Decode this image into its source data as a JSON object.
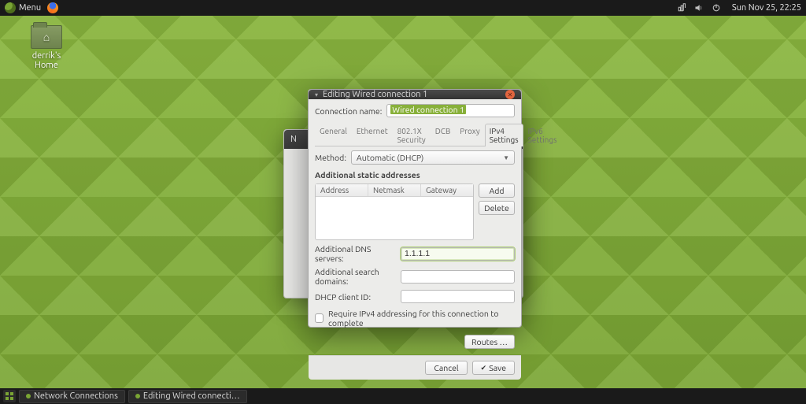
{
  "top_panel": {
    "menu_label": "Menu",
    "clock": "Sun Nov 25, 22:25"
  },
  "desktop": {
    "home_folder_label": "derrik's Home"
  },
  "bottom_panel": {
    "task1": "Network Connections",
    "task2": "Editing Wired connecti…"
  },
  "back_dialog": {
    "title": "N"
  },
  "dialog": {
    "title": "Editing Wired connection 1",
    "conn_name_label": "Connection name:",
    "conn_name_value": "Wired connection 1",
    "tabs": {
      "general": "General",
      "ethernet": "Ethernet",
      "security": "802.1X Security",
      "dcb": "DCB",
      "proxy": "Proxy",
      "ipv4": "IPv4 Settings",
      "ipv6": "IPv6 Settings"
    },
    "method_label": "Method:",
    "method_value": "Automatic (DHCP)",
    "addresses_section": "Additional static addresses",
    "addr_headers": {
      "address": "Address",
      "netmask": "Netmask",
      "gateway": "Gateway"
    },
    "add_btn": "Add",
    "delete_btn": "Delete",
    "dns_label": "Additional DNS servers:",
    "dns_value": "1.1.1.1",
    "search_label": "Additional search domains:",
    "search_value": "",
    "dhcp_label": "DHCP client ID:",
    "dhcp_value": "",
    "require_label": "Require IPv4 addressing for this connection to complete",
    "routes_btn": "Routes …",
    "cancel_btn": "Cancel",
    "save_btn": "Save"
  }
}
